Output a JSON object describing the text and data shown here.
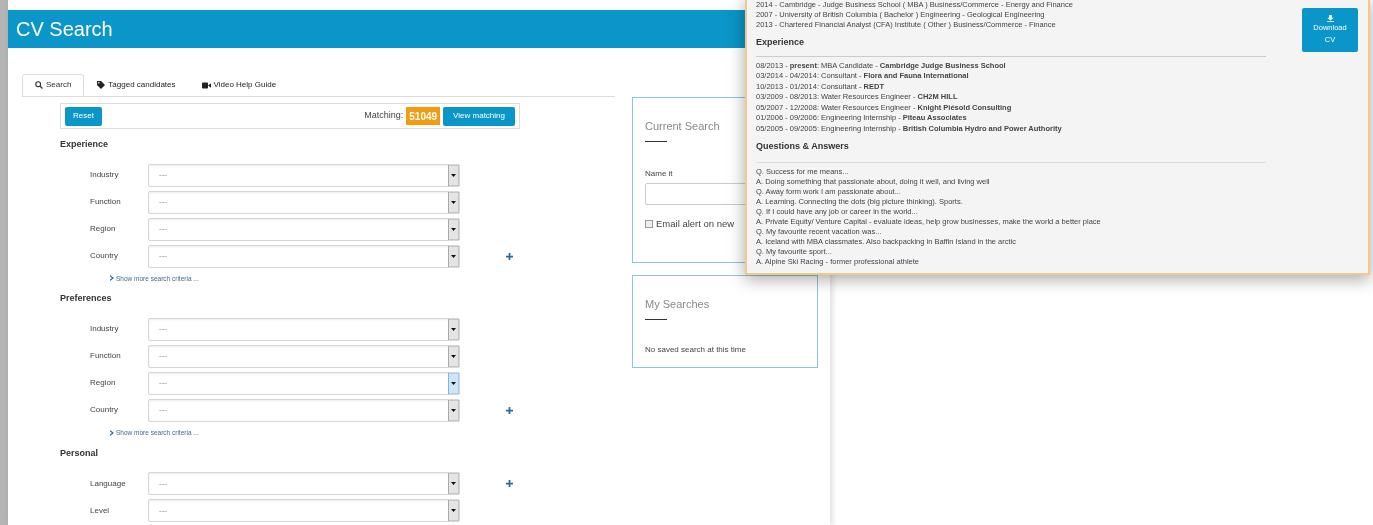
{
  "header": {
    "title": "CV Search"
  },
  "tabs": [
    {
      "label": "Search",
      "selected": true
    },
    {
      "label": "Tagged candidates",
      "selected": false
    },
    {
      "label": "Video Help Guide",
      "selected": false
    }
  ],
  "toolbar": {
    "reset": "Reset",
    "matching_label": "Matching:",
    "matching_count": "51049",
    "view": "View matching"
  },
  "sections": [
    {
      "title": "Experience",
      "fields": [
        {
          "label": "Industry",
          "value": "---",
          "highlighted": false,
          "add": false
        },
        {
          "label": "Function",
          "value": "---",
          "highlighted": false,
          "add": false
        },
        {
          "label": "Region",
          "value": "---",
          "highlighted": false,
          "add": false
        },
        {
          "label": "Country",
          "value": "---",
          "highlighted": false,
          "add": true
        }
      ],
      "more": "Show more search criteria ..."
    },
    {
      "title": "Preferences",
      "fields": [
        {
          "label": "Industry",
          "value": "---",
          "highlighted": false,
          "add": false
        },
        {
          "label": "Function",
          "value": "---",
          "highlighted": false,
          "add": false
        },
        {
          "label": "Region",
          "value": "---",
          "highlighted": true,
          "add": false
        },
        {
          "label": "Country",
          "value": "---",
          "highlighted": false,
          "add": true
        }
      ],
      "more": "Show more search criteria ..."
    },
    {
      "title": "Personal",
      "fields": [
        {
          "label": "Language",
          "value": "---",
          "highlighted": false,
          "add": true
        },
        {
          "label": "Level",
          "value": "---",
          "highlighted": false,
          "add": false
        }
      ]
    }
  ],
  "current_search": {
    "title": "Current Search",
    "name_label": "Name it",
    "email_alert": "Email alert on new",
    "email_checked": false
  },
  "my_searches": {
    "title": "My Searches",
    "empty": "No saved search at this time"
  },
  "profile": {
    "education": [
      "2014 - Cambridge - Judge Business School ( MBA ) Business/Commerce - Energy and Finance",
      "2007 - University of British Columbia ( Bachelor ) Engineering - Geological Engineering",
      "2013 - Chartered Financial Analyst (CFA) Institute ( Other ) Business/Commerce - Finance"
    ],
    "download": [
      "Download",
      "CV"
    ],
    "experience_title": "Experience",
    "experience": [
      "08/2013 - **present**: MBA Candidate - **Cambridge Judge Business School**",
      "03/2014 - 04/2014: Consultant - **Flora and Fauna International**",
      "10/2013 - 01/2014: Consultant - **REDT**",
      "03/2009 - 08/2013: Water Resources Engineer - **CH2M HILL**",
      "05/2007 - 12/2008: Water Resources Engineer - **Knight Piésold Consulting**",
      "01/2006 - 09/2006: Engineering Internship - **Piteau Associates**",
      "05/2005 - 09/2005: Engineering Internship - **British Columbia Hydro and Power Authority**"
    ],
    "qa_title": "Questions & Answers",
    "qa": [
      "Q. Success for me means...",
      "A. Doing something that passionate about, doing it well, and living well",
      "Q. Away form work I am passionate about...",
      "A. Learning. Connecting the dots (big picture thinking). Sports.",
      "Q. If I could have any job or career in the world...",
      "A. Private Equity/ Venture Capital - evaluate ideas, help grow businesses, make the world a better place",
      "Q. My favourite recent vacation was...",
      "A. Iceland with MBA classmates. Also backpacking in Baffin Island in the arctic",
      "Q. My favourite sport...",
      "A. Alpine Ski Racing - former professional athlete"
    ]
  }
}
